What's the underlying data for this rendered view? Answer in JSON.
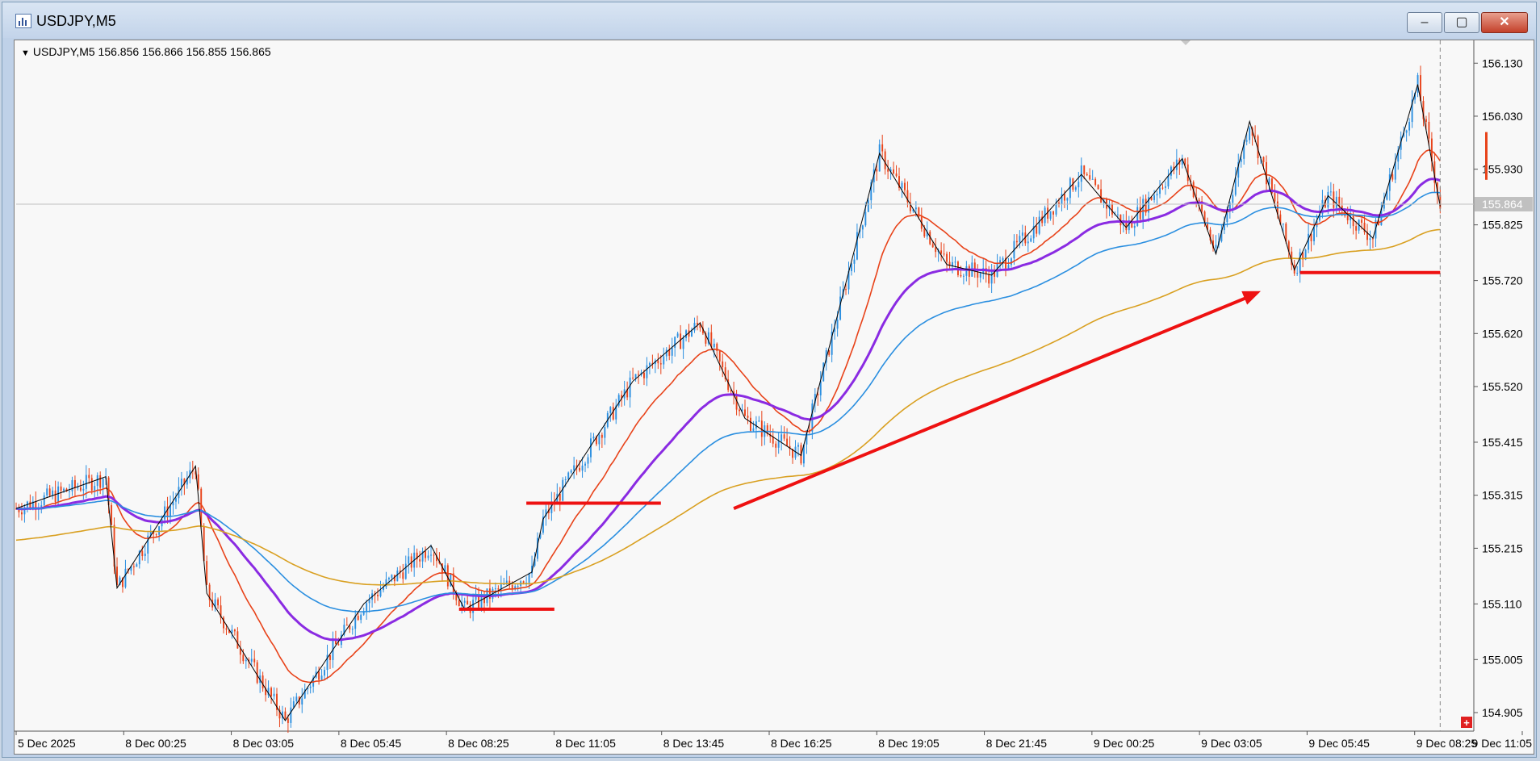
{
  "window": {
    "title": "USDJPY,M5",
    "controls": {
      "minimize": "‒",
      "maximize": "▢",
      "close": "✕"
    }
  },
  "chart": {
    "info": "USDJPY,M5  156.856 156.866 156.855 156.865",
    "current_price_label": "155.864",
    "corner_button": "+"
  },
  "chart_data": {
    "type": "candlestick",
    "symbol": "USDJPY",
    "timeframe": "M5",
    "ohlc_header": {
      "open": 156.856,
      "high": 156.866,
      "low": 156.855,
      "close": 156.865
    },
    "current_price": 155.864,
    "y_ticks": [
      "156.130",
      "156.030",
      "155.930",
      "155.825",
      "155.720",
      "155.620",
      "155.520",
      "155.415",
      "155.315",
      "155.215",
      "155.110",
      "155.005",
      "154.905"
    ],
    "x_ticks": [
      "5 Dec 2025",
      "8 Dec 00:25",
      "8 Dec 03:05",
      "8 Dec 05:45",
      "8 Dec 08:25",
      "8 Dec 11:05",
      "8 Dec 13:45",
      "8 Dec 16:25",
      "8 Dec 19:05",
      "8 Dec 21:45",
      "9 Dec 00:25",
      "9 Dec 03:05",
      "9 Dec 05:45",
      "9 Dec 08:25",
      "9 Dec 11:05"
    ],
    "ylim": [
      154.87,
      156.17
    ],
    "zigzag_pivots": [
      {
        "x": 0,
        "y": 155.29
      },
      {
        "x": 8,
        "y": 155.35
      },
      {
        "x": 9,
        "y": 155.14
      },
      {
        "x": 16,
        "y": 155.37
      },
      {
        "x": 17,
        "y": 155.13
      },
      {
        "x": 24,
        "y": 154.89
      },
      {
        "x": 31,
        "y": 155.11
      },
      {
        "x": 37,
        "y": 155.22
      },
      {
        "x": 40,
        "y": 155.1
      },
      {
        "x": 46,
        "y": 155.17
      },
      {
        "x": 47,
        "y": 155.27
      },
      {
        "x": 55,
        "y": 155.53
      },
      {
        "x": 61,
        "y": 155.64
      },
      {
        "x": 65,
        "y": 155.46
      },
      {
        "x": 70,
        "y": 155.39
      },
      {
        "x": 77,
        "y": 155.96
      },
      {
        "x": 83,
        "y": 155.75
      },
      {
        "x": 87,
        "y": 155.73
      },
      {
        "x": 95,
        "y": 155.92
      },
      {
        "x": 99,
        "y": 155.82
      },
      {
        "x": 104,
        "y": 155.95
      },
      {
        "x": 107,
        "y": 155.77
      },
      {
        "x": 110,
        "y": 156.02
      },
      {
        "x": 114,
        "y": 155.74
      },
      {
        "x": 117,
        "y": 155.88
      },
      {
        "x": 121,
        "y": 155.8
      },
      {
        "x": 125,
        "y": 156.09
      },
      {
        "x": 127,
        "y": 155.86
      }
    ],
    "moving_averages": [
      {
        "color": "#e8431a"
      },
      {
        "color": "#8a2be2"
      },
      {
        "color": "#2b8fe0"
      },
      {
        "color": "#d9a021"
      }
    ],
    "annotations": [
      {
        "type": "level",
        "price": 155.3,
        "color": "#ee1111"
      },
      {
        "type": "level",
        "price": 155.1,
        "color": "#ee1111"
      },
      {
        "type": "level",
        "price": 155.735,
        "color": "#ee1111"
      },
      {
        "type": "arrow",
        "from": {
          "x": 64,
          "y": 155.29
        },
        "to": {
          "x": 111,
          "y": 155.7
        },
        "color": "#ee1111"
      }
    ],
    "colors": {
      "bull": "#2b8fe0",
      "bear": "#e8431a",
      "background": "#f8f8f8"
    }
  }
}
